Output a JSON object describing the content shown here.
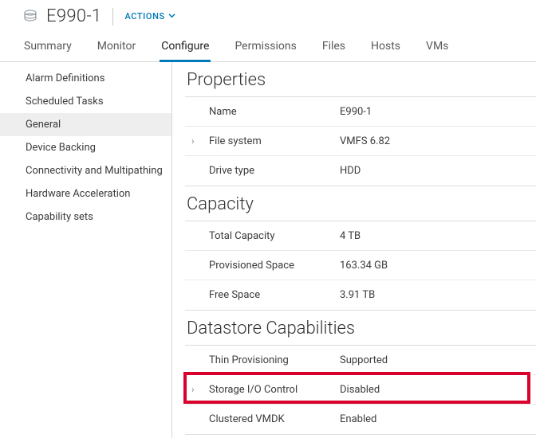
{
  "header": {
    "title": "E990-1",
    "actions_label": "ACTIONS"
  },
  "tabs": [
    {
      "label": "Summary"
    },
    {
      "label": "Monitor"
    },
    {
      "label": "Configure"
    },
    {
      "label": "Permissions"
    },
    {
      "label": "Files"
    },
    {
      "label": "Hosts"
    },
    {
      "label": "VMs"
    }
  ],
  "sidebar": {
    "items": [
      {
        "label": "Alarm Definitions"
      },
      {
        "label": "Scheduled Tasks"
      },
      {
        "label": "General"
      },
      {
        "label": "Device Backing"
      },
      {
        "label": "Connectivity and Multipathing"
      },
      {
        "label": "Hardware Acceleration"
      },
      {
        "label": "Capability sets"
      }
    ]
  },
  "sections": {
    "properties": {
      "title": "Properties",
      "rows": [
        {
          "label": "Name",
          "value": "E990-1"
        },
        {
          "label": "File system",
          "value": "VMFS 6.82"
        },
        {
          "label": "Drive type",
          "value": "HDD"
        }
      ]
    },
    "capacity": {
      "title": "Capacity",
      "rows": [
        {
          "label": "Total Capacity",
          "value": "4 TB"
        },
        {
          "label": "Provisioned Space",
          "value": "163.34 GB"
        },
        {
          "label": "Free Space",
          "value": "3.91 TB"
        }
      ]
    },
    "capabilities": {
      "title": "Datastore Capabilities",
      "rows": [
        {
          "label": "Thin Provisioning",
          "value": "Supported"
        },
        {
          "label": "Storage I/O Control",
          "value": "Disabled"
        },
        {
          "label": "Clustered VMDK",
          "value": "Enabled"
        }
      ]
    }
  }
}
